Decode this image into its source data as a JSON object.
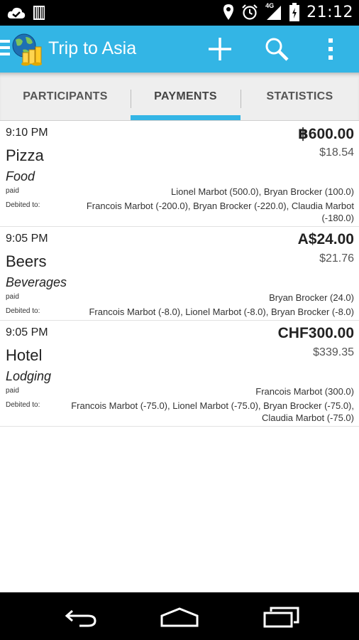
{
  "status_bar": {
    "time": "21:12",
    "network_label": "4G",
    "icons": [
      "cloud-check-icon",
      "barcode-icon",
      "location-icon",
      "alarm-icon",
      "signal-icon",
      "battery-icon"
    ]
  },
  "action_bar": {
    "title": "Trip to Asia",
    "icons": [
      "menu-icon",
      "app-logo",
      "add-icon",
      "search-icon",
      "overflow-menu-icon"
    ],
    "color": "#33b5e5"
  },
  "tabs": [
    {
      "label": "PARTICIPANTS",
      "selected": false
    },
    {
      "label": "PAYMENTS",
      "selected": true
    },
    {
      "label": "STATISTICS",
      "selected": false
    }
  ],
  "payments": [
    {
      "time": "9:10 PM",
      "amount": "฿600.00",
      "converted": "$18.54",
      "name": "Pizza",
      "category": "Food",
      "paid_label": "paid",
      "paid_by": "Lionel Marbot (500.0), Bryan Brocker (100.0)",
      "debited_label": "Debited to:",
      "debited_to": "Francois Marbot (-200.0), Bryan Brocker (-220.0), Claudia Marbot (-180.0)"
    },
    {
      "time": "9:05 PM",
      "amount": "A$24.00",
      "converted": "$21.76",
      "name": "Beers",
      "category": "Beverages",
      "paid_label": "paid",
      "paid_by": "Bryan Brocker (24.0)",
      "debited_label": "Debited to:",
      "debited_to": "Francois Marbot (-8.0), Lionel Marbot (-8.0), Bryan Brocker (-8.0)"
    },
    {
      "time": "9:05 PM",
      "amount": "CHF300.00",
      "converted": "$339.35",
      "name": "Hotel",
      "category": "Lodging",
      "paid_label": "paid",
      "paid_by": "Francois Marbot (300.0)",
      "debited_label": "Debited to:",
      "debited_to": "Francois Marbot (-75.0), Lionel Marbot (-75.0), Bryan Brocker (-75.0), Claudia Marbot (-75.0)"
    }
  ],
  "nav_bar": {
    "icons": [
      "back-icon",
      "home-icon",
      "recent-apps-icon"
    ]
  }
}
